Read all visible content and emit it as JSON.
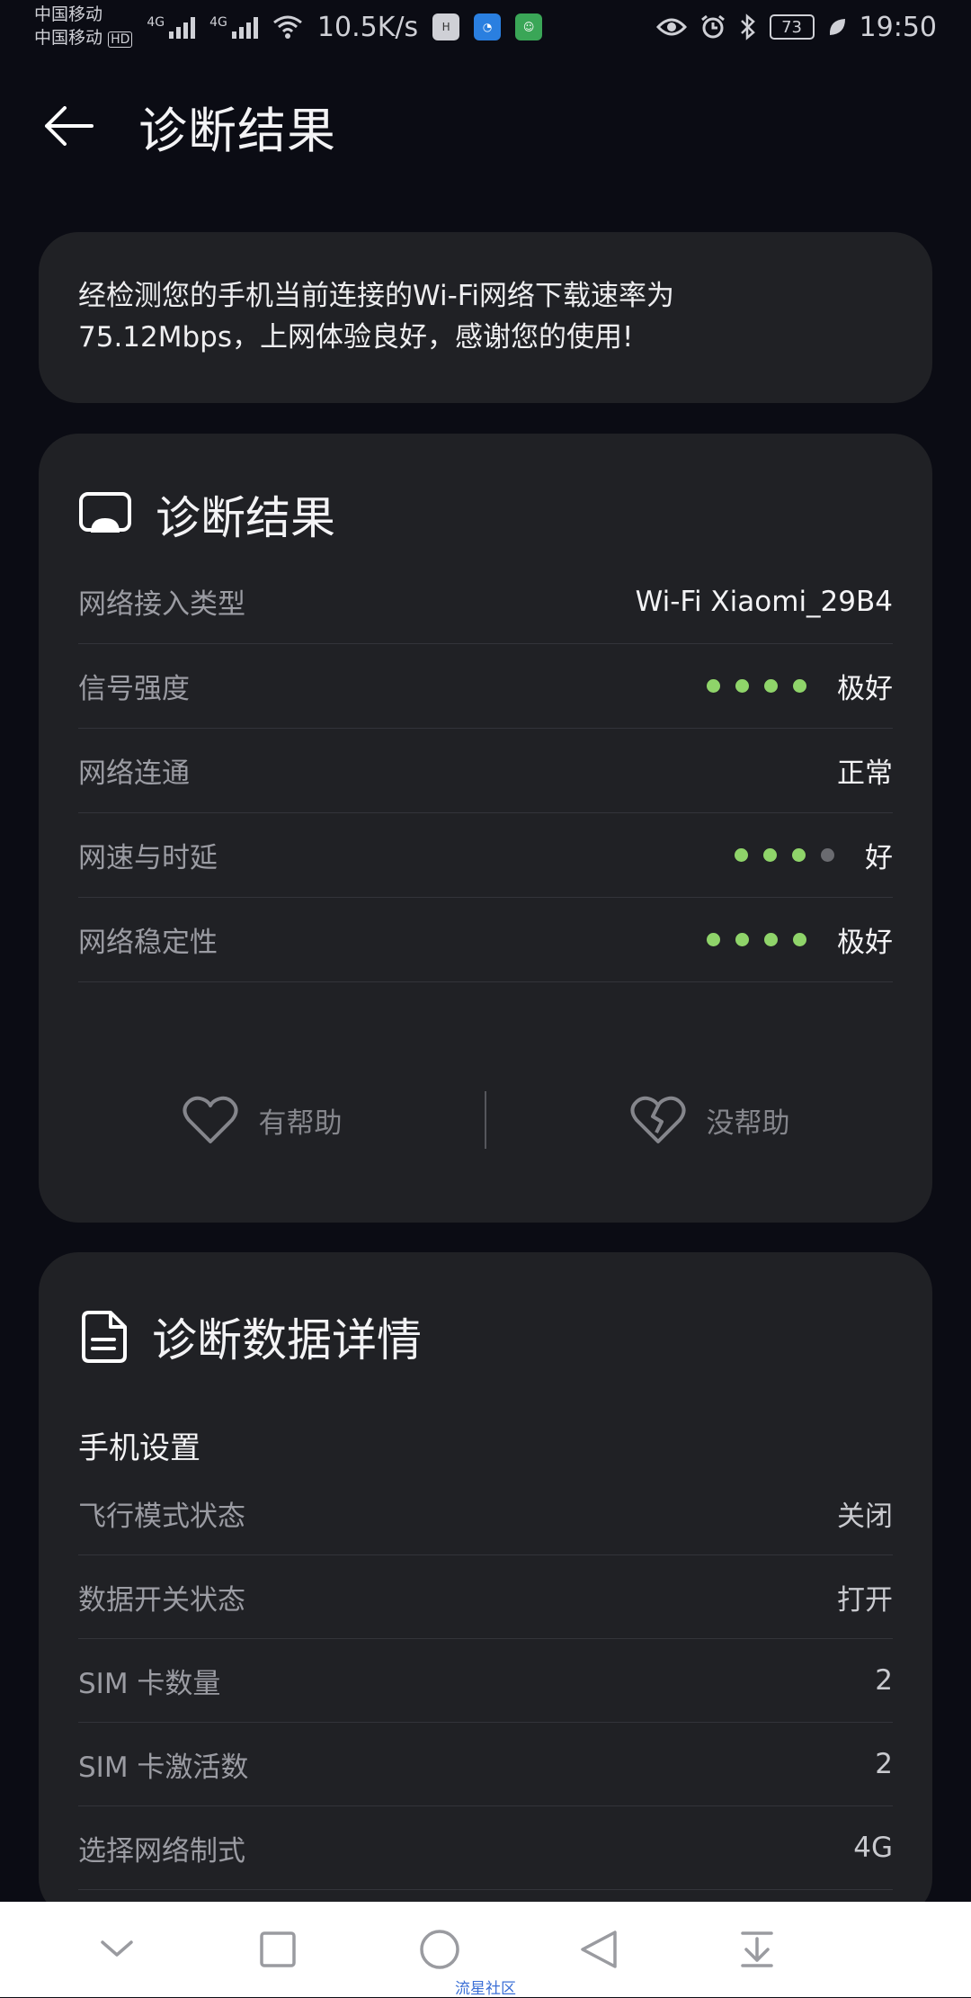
{
  "status_bar": {
    "carrier1": "中国移动",
    "carrier2": "中国移动",
    "hd": "HD",
    "net1": "4G",
    "net2": "4G",
    "speed": "10.5K/s",
    "battery": "73",
    "time": "19:50",
    "icons": [
      "wifi-icon",
      "huawei-icon",
      "browser-app-icon",
      "assistant-app-icon",
      "eye-icon",
      "alarm-icon",
      "bluetooth-icon",
      "battery-icon",
      "leaf-icon"
    ]
  },
  "header": {
    "title": "诊断结果",
    "back_icon": "arrow-left-icon"
  },
  "summary": {
    "text_line1": "经检测您的手机当前连接的Wi-Fi网络下载速率为",
    "text_line2": "75.12Mbps，上网体验良好，感谢您的使用!"
  },
  "result": {
    "title": "诊断结果",
    "icon": "cast-screen-icon",
    "rows": [
      {
        "label": "网络接入类型",
        "value": "Wi-Fi Xiaomi_29B4"
      },
      {
        "label": "信号强度",
        "value": "极好",
        "rating": 4,
        "rating_max": 4
      },
      {
        "label": "网络连通",
        "value": "正常"
      },
      {
        "label": "网速与时延",
        "value": "好",
        "rating": 3,
        "rating_max": 4
      },
      {
        "label": "网络稳定性",
        "value": "极好",
        "rating": 4,
        "rating_max": 4
      }
    ],
    "helpful": "有帮助",
    "not_helpful": "没帮助"
  },
  "details": {
    "title": "诊断数据详情",
    "icon": "document-icon",
    "section": "手机设置",
    "rows": [
      {
        "label": "飞行模式状态",
        "value": "关闭"
      },
      {
        "label": "数据开关状态",
        "value": "打开"
      },
      {
        "label": "SIM 卡数量",
        "value": "2"
      },
      {
        "label": "SIM 卡激活数",
        "value": "2"
      },
      {
        "label": "选择网络制式",
        "value": "4G"
      }
    ]
  },
  "nav": {
    "watermark": "流星社区",
    "buttons": [
      "chevron-down-icon",
      "square-icon",
      "circle-icon",
      "triangle-back-icon",
      "pull-down-icon"
    ]
  },
  "colors": {
    "background": "#0b0c14",
    "card": "#202125",
    "rating_on": "#8fd46a",
    "rating_off": "#6a6b70"
  }
}
